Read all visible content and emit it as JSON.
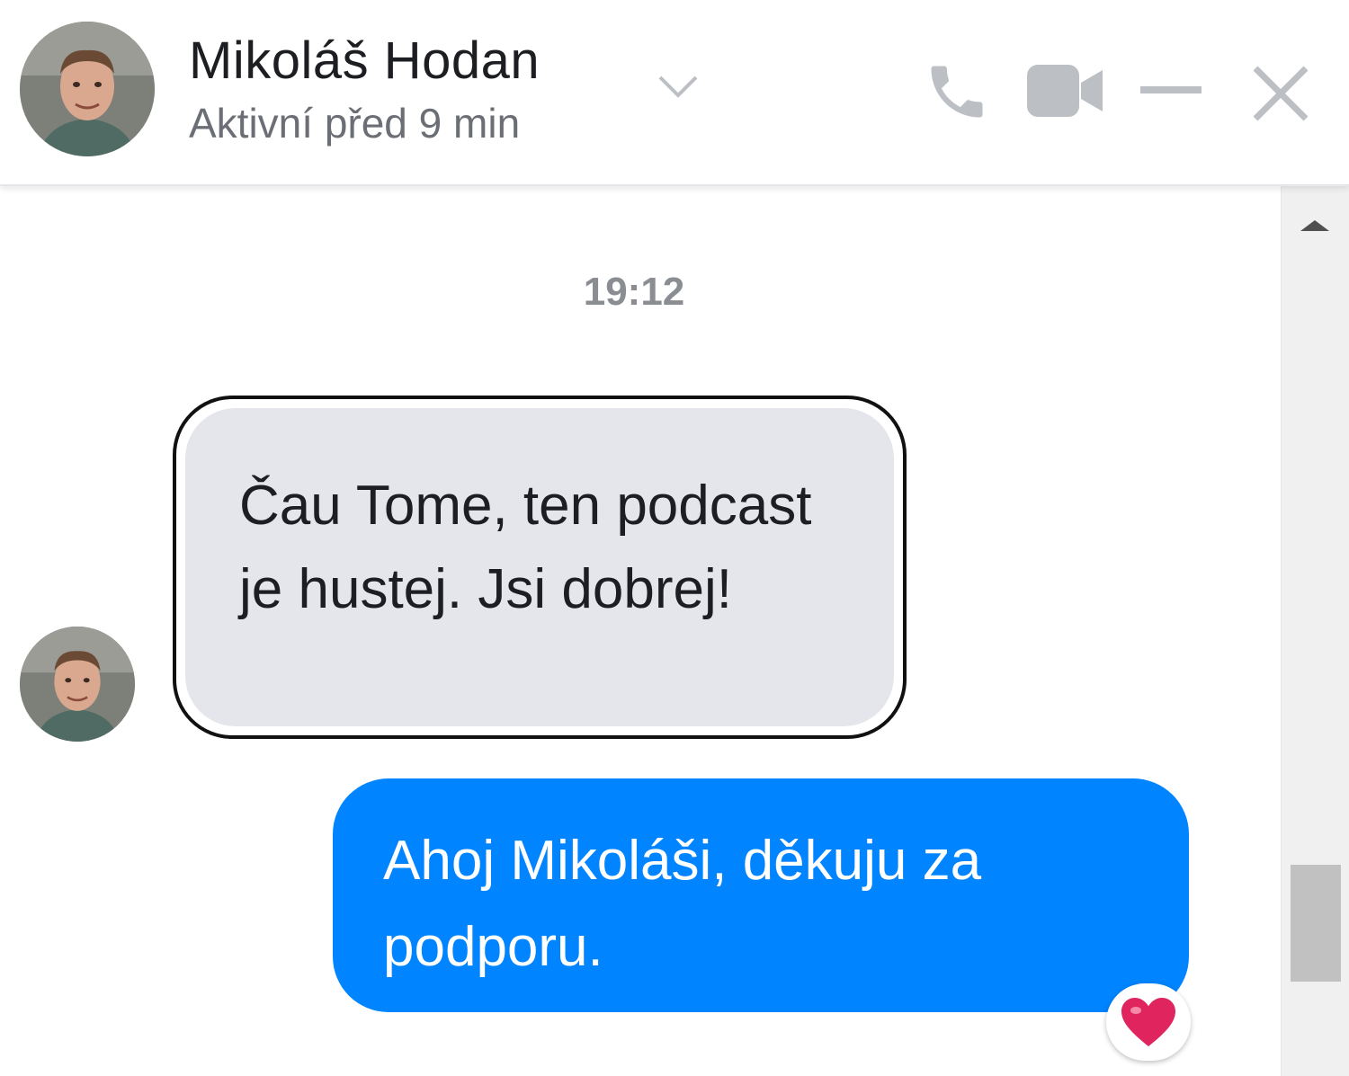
{
  "header": {
    "contact_name": "Mikoláš Hodan",
    "status": "Aktivní před 9 min",
    "icons": [
      "chevron-down-icon",
      "phone-icon",
      "video-camera-icon",
      "minimize-icon",
      "close-icon"
    ]
  },
  "conversation": {
    "timestamp": "19:12",
    "messages": [
      {
        "direction": "incoming",
        "text": "Čau Tome, ten podcast je hustej. Jsi dobrej!"
      },
      {
        "direction": "outgoing",
        "text": "Ahoj Mikoláši, děkuju za podporu.",
        "reaction": "heart-icon"
      }
    ]
  },
  "colors": {
    "outgoing_bubble": "#0084ff",
    "incoming_bubble": "#e4e6eb",
    "icon_gray": "#bcc0c4",
    "heart": "#e0245e"
  }
}
